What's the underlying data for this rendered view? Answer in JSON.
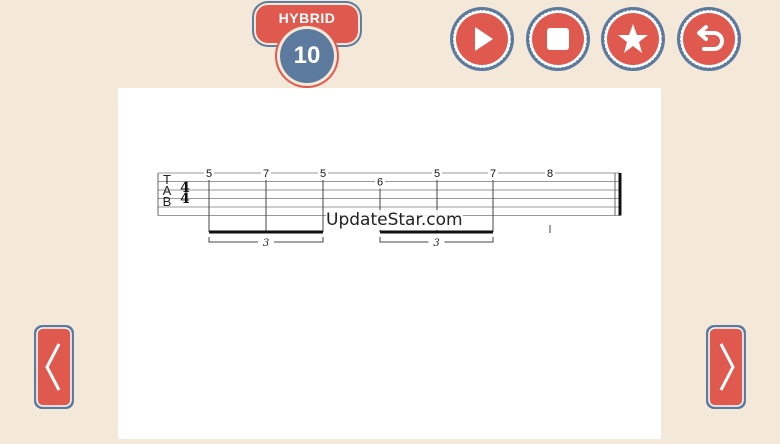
{
  "level": {
    "mode": "HYBRID",
    "number": "10"
  },
  "controls": [
    {
      "name": "play-button",
      "icon": "play-icon"
    },
    {
      "name": "stop-button",
      "icon": "stop-icon"
    },
    {
      "name": "favorite-button",
      "icon": "star-icon"
    },
    {
      "name": "back-button",
      "icon": "undo-arrow-icon"
    }
  ],
  "tab": {
    "clef": [
      "T",
      "A",
      "B"
    ],
    "time_signature": {
      "top": "4",
      "bottom": "4"
    },
    "notes": [
      {
        "string": 1,
        "fret": "5"
      },
      {
        "string": 1,
        "fret": "7"
      },
      {
        "string": 1,
        "fret": "5"
      },
      {
        "string": 2,
        "fret": "6"
      },
      {
        "string": 1,
        "fret": "5"
      },
      {
        "string": 1,
        "fret": "7"
      },
      {
        "string": 1,
        "fret": "8"
      }
    ],
    "tuplets": [
      {
        "label": "3"
      },
      {
        "label": "3"
      }
    ]
  },
  "watermark": "UpdateStar.com",
  "nav": {
    "prev": "prev-arrow-icon",
    "next": "next-arrow-icon"
  },
  "colors": {
    "background": "#f4e8d8",
    "accent_red": "#e0594f",
    "accent_blue": "#5c7a9e",
    "sheet": "#ffffff"
  }
}
